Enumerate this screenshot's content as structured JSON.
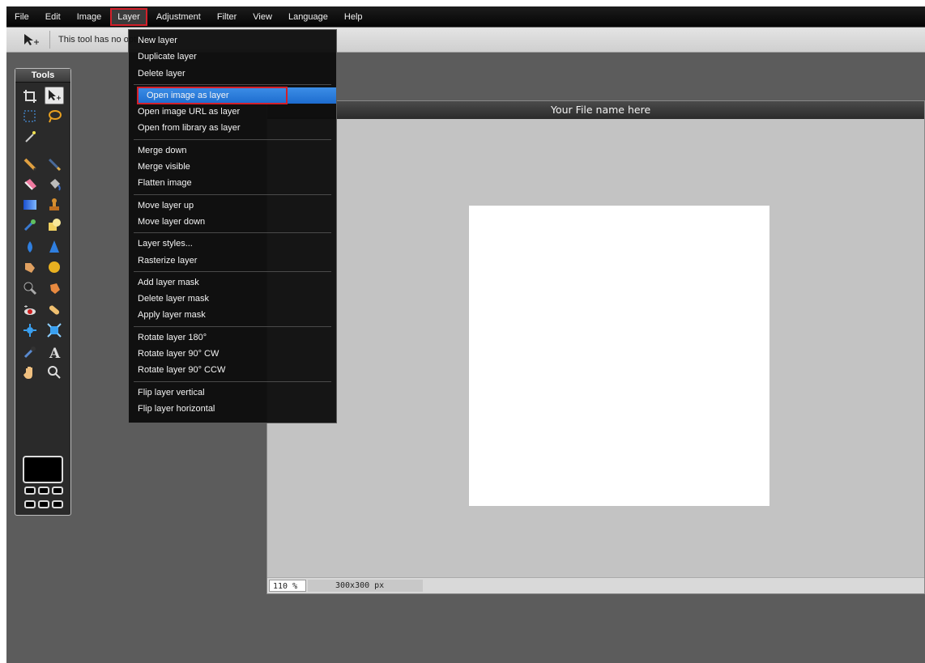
{
  "menubar": {
    "items": [
      "File",
      "Edit",
      "Image",
      "Layer",
      "Adjustment",
      "Filter",
      "View",
      "Language",
      "Help"
    ],
    "active": "Layer"
  },
  "options_bar": {
    "tool_icon": "move-tool-icon",
    "text": "This tool has no options"
  },
  "tools_panel": {
    "title": "Tools",
    "tools": [
      "crop-icon",
      "move-icon",
      "marquee-select-icon",
      "lasso-icon",
      "magic-wand-icon",
      "",
      "pencil-icon",
      "brush-icon",
      "eraser-icon",
      "paint-bucket-icon",
      "gradient-icon",
      "clone-stamp-icon",
      "color-replace-icon",
      "shape-icon",
      "blur-icon",
      "sharpen-icon",
      "smudge-icon",
      "sponge-icon",
      "burn-icon",
      "dodge-icon",
      "red-eye-icon",
      "spot-heal-icon",
      "bloat-icon",
      "pinch-icon",
      "color-picker-icon",
      "type-icon",
      "hand-icon",
      "zoom-icon"
    ],
    "selected_tool": "move-icon",
    "foreground_color": "#000000"
  },
  "document": {
    "title": "Your File name here",
    "zoom": "110 %",
    "size": "300x300 px",
    "canvas_color": "#ffffff"
  },
  "layer_menu": {
    "groups": [
      [
        "New layer",
        "Duplicate layer",
        "Delete layer"
      ],
      [
        "Open image as layer",
        "Open image URL as layer",
        "Open from library as layer"
      ],
      [
        "Merge down",
        "Merge visible",
        "Flatten image"
      ],
      [
        "Move layer up",
        "Move layer down"
      ],
      [
        "Layer styles...",
        "Rasterize layer"
      ],
      [
        "Add layer mask",
        "Delete layer mask",
        "Apply layer mask"
      ],
      [
        "Rotate layer 180°",
        "Rotate layer 90° CW",
        "Rotate layer 90° CCW"
      ],
      [
        "Flip layer vertical",
        "Flip layer horizontal"
      ]
    ],
    "highlighted": "Open image as layer"
  },
  "colors": {
    "highlight": "#2a7ddb",
    "annotation_outline": "#d3202a"
  }
}
